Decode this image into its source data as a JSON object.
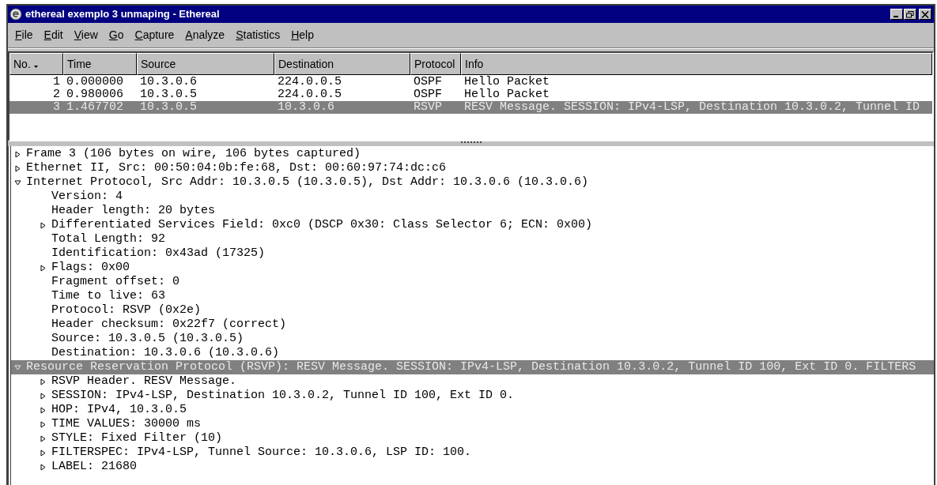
{
  "window": {
    "title": "ethereal exemplo 3 unmaping - Ethereal"
  },
  "menu": [
    {
      "label": "File"
    },
    {
      "label": "Edit"
    },
    {
      "label": "View"
    },
    {
      "label": "Go"
    },
    {
      "label": "Capture"
    },
    {
      "label": "Analyze"
    },
    {
      "label": "Statistics"
    },
    {
      "label": "Help"
    }
  ],
  "packet_list": {
    "columns": [
      {
        "label": "No.",
        "sorted": true
      },
      {
        "label": "Time",
        "sorted": false
      },
      {
        "label": "Source",
        "sorted": false
      },
      {
        "label": "Destination",
        "sorted": false
      },
      {
        "label": "Protocol",
        "sorted": false
      },
      {
        "label": "Info",
        "sorted": false
      }
    ],
    "rows": [
      {
        "cells": [
          "1",
          "0.000000",
          "10.3.0.6",
          "224.0.0.5",
          "OSPF",
          "Hello Packet"
        ],
        "selected": false
      },
      {
        "cells": [
          "2",
          "0.980006",
          "10.3.0.5",
          "224.0.0.5",
          "OSPF",
          "Hello Packet"
        ],
        "selected": false
      },
      {
        "cells": [
          "3",
          "1.467702",
          "10.3.0.5",
          "10.3.0.6",
          "RSVP",
          "RESV Message. SESSION: IPv4-LSP, Destination 10.3.0.2, Tunnel ID"
        ],
        "selected": true
      }
    ]
  },
  "details": [
    {
      "text": "Frame 3 (106 bytes on wire, 106 bytes captured)",
      "kind": "node",
      "expanded": false,
      "selected": false
    },
    {
      "text": "Ethernet II, Src: 00:50:04:0b:fe:68, Dst: 00:60:97:74:dc:c6",
      "kind": "node",
      "expanded": false,
      "selected": false
    },
    {
      "text": "Internet Protocol, Src Addr: 10.3.0.5 (10.3.0.5), Dst Addr: 10.3.0.6 (10.3.0.6)",
      "kind": "node",
      "expanded": true,
      "selected": false,
      "children": [
        {
          "text": "Version: 4",
          "kind": "leaf",
          "selected": false
        },
        {
          "text": "Header length: 20 bytes",
          "kind": "leaf",
          "selected": false
        },
        {
          "text": "Differentiated Services Field: 0xc0 (DSCP 0x30: Class Selector 6; ECN: 0x00)",
          "kind": "node",
          "expanded": false,
          "selected": false
        },
        {
          "text": "Total Length: 92",
          "kind": "leaf",
          "selected": false
        },
        {
          "text": "Identification: 0x43ad (17325)",
          "kind": "leaf",
          "selected": false
        },
        {
          "text": "Flags: 0x00",
          "kind": "node",
          "expanded": false,
          "selected": false
        },
        {
          "text": "Fragment offset: 0",
          "kind": "leaf",
          "selected": false
        },
        {
          "text": "Time to live: 63",
          "kind": "leaf",
          "selected": false
        },
        {
          "text": "Protocol: RSVP (0x2e)",
          "kind": "leaf",
          "selected": false
        },
        {
          "text": "Header checksum: 0x22f7 (correct)",
          "kind": "leaf",
          "selected": false
        },
        {
          "text": "Source: 10.3.0.5 (10.3.0.5)",
          "kind": "leaf",
          "selected": false
        },
        {
          "text": "Destination: 10.3.0.6 (10.3.0.6)",
          "kind": "leaf",
          "selected": false
        }
      ]
    },
    {
      "text": "Resource Reservation Protocol (RSVP): RESV Message. SESSION: IPv4-LSP, Destination 10.3.0.2, Tunnel ID 100, Ext ID 0. FILTERS",
      "kind": "node",
      "expanded": true,
      "selected": true,
      "children": [
        {
          "text": "RSVP Header. RESV Message.",
          "kind": "node",
          "expanded": false,
          "selected": false
        },
        {
          "text": "SESSION: IPv4-LSP, Destination 10.3.0.2, Tunnel ID 100, Ext ID 0.",
          "kind": "node",
          "expanded": false,
          "selected": false
        },
        {
          "text": "HOP: IPv4, 10.3.0.5",
          "kind": "node",
          "expanded": false,
          "selected": false
        },
        {
          "text": "TIME VALUES: 30000 ms",
          "kind": "node",
          "expanded": false,
          "selected": false
        },
        {
          "text": "STYLE: Fixed Filter (10)",
          "kind": "node",
          "expanded": false,
          "selected": false
        },
        {
          "text": "FILTERSPEC: IPv4-LSP, Tunnel Source: 10.3.0.6, LSP ID: 100.",
          "kind": "node",
          "expanded": false,
          "selected": false
        },
        {
          "text": "LABEL: 21680",
          "kind": "node",
          "expanded": false,
          "selected": false
        }
      ]
    }
  ]
}
